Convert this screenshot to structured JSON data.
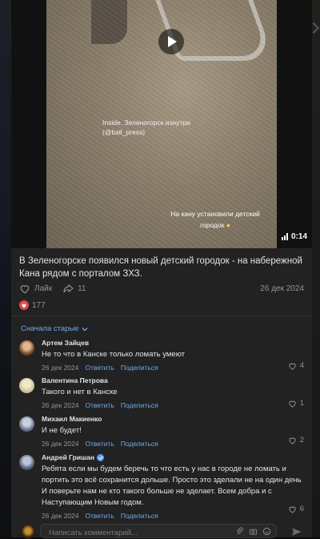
{
  "video": {
    "watermark_line1": "Inside. Зеленогорск изнутри",
    "watermark_line2": "(@ball_press)",
    "caption_line1": "На кану установили детский",
    "caption_line2": "городок",
    "duration": "0:14"
  },
  "post": {
    "text": "В Зеленогорске появился новый детский городок - на набережной Кана рядом с порталом ЗХЗ.",
    "like_label": "Лайк",
    "shares": "11",
    "date": "26 дек 2024",
    "reactions_count": "177"
  },
  "comments_header": {
    "older_label": "Сначала старые"
  },
  "comments": [
    {
      "name": "Артем Зайцев",
      "text": "Не то что в Канске только ломать умеют",
      "date": "26 дек 2024",
      "reply": "Ответить",
      "share": "Поделиться",
      "likes": "4"
    },
    {
      "name": "Валентина Петрова",
      "text": "Такого и нет в Канске",
      "date": "26 дек 2024",
      "reply": "Ответить",
      "share": "Поделиться",
      "likes": "1"
    },
    {
      "name": "Михаил Макиенко",
      "text": "И не будет!",
      "date": "26 дек 2024",
      "reply": "Ответить",
      "share": "Поделиться",
      "likes": "2"
    },
    {
      "name": "Андрей Гришан",
      "text": "Ребята если мы будем беречь то что есть у нас в городе не ломать и портить это всё сохранится дольше. Просто это зделали не на один день И поверьте нам не кто такого больше не зделает. Всем добра и с Наступающим Новым годом.",
      "date": "26 дек 2024",
      "reply": "Ответить",
      "share": "Поделиться",
      "likes": "6"
    }
  ],
  "composer": {
    "placeholder": "Написать комментарий..."
  },
  "colors": {
    "accent": "#71aaeb",
    "heart": "#e64646",
    "card_bg": "#222222"
  }
}
